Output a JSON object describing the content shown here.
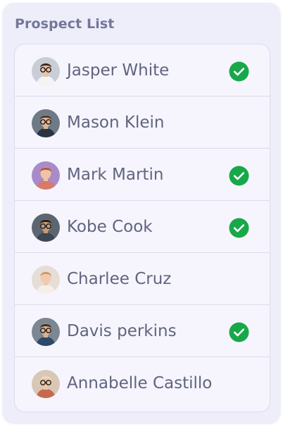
{
  "panel": {
    "title": "Prospect List"
  },
  "prospects": [
    {
      "name": "Jasper White",
      "checked": true,
      "avatar": {
        "bg": "#c9cdd6",
        "skin": "#e9c2a6",
        "hair": "#3a2b22",
        "shirt": "#f4f4f4",
        "glasses": true
      }
    },
    {
      "name": "Mason Klein",
      "checked": false,
      "avatar": {
        "bg": "#6e7a86",
        "skin": "#e2b595",
        "hair": "#4a3524",
        "shirt": "#2b3440",
        "glasses": true
      }
    },
    {
      "name": "Mark Martin",
      "checked": true,
      "avatar": {
        "bg": "#a98bc9",
        "skin": "#f0c3a4",
        "hair": "#b0552c",
        "shirt": "#d77a6a",
        "glasses": false
      }
    },
    {
      "name": "Kobe Cook",
      "checked": true,
      "avatar": {
        "bg": "#5c6570",
        "skin": "#c99a78",
        "hair": "#1f1a17",
        "shirt": "#3c4654",
        "glasses": true
      }
    },
    {
      "name": "Charlee Cruz",
      "checked": false,
      "avatar": {
        "bg": "#e6ddd6",
        "skin": "#f1c9ad",
        "hair": "#c79a6c",
        "shirt": "#f5efe8",
        "glasses": false
      }
    },
    {
      "name": "Davis perkins",
      "checked": true,
      "avatar": {
        "bg": "#7c8794",
        "skin": "#ddb08f",
        "hair": "#3b2c22",
        "shirt": "#2e4868",
        "glasses": true
      }
    },
    {
      "name": "Annabelle Castillo",
      "checked": false,
      "avatar": {
        "bg": "#d9c7b6",
        "skin": "#f0c6a2",
        "hair": "#e8d9c0",
        "shirt": "#c56a4f",
        "glasses": true
      }
    }
  ],
  "colors": {
    "check": "#17a84a",
    "name_text": "#60647f",
    "title_text": "#74779a"
  },
  "icons": {
    "check": "check-circle-icon",
    "avatar": "user-avatar"
  }
}
